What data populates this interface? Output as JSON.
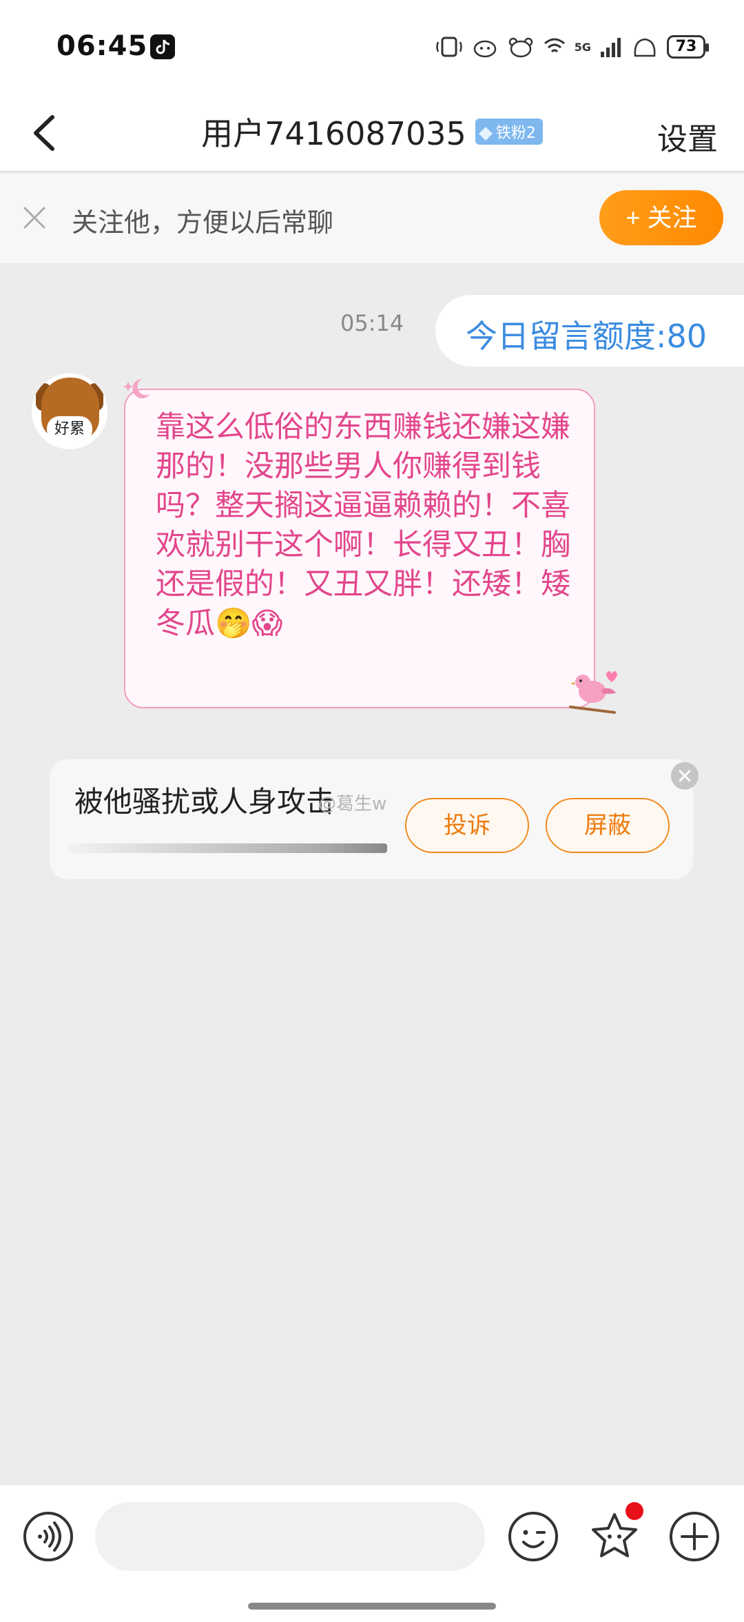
{
  "status_bar": {
    "time": "06:45",
    "app_icon": "tiktok-icon",
    "network": "5G",
    "battery": "73"
  },
  "header": {
    "back_icon": "chevron-left-icon",
    "title": "用户7416087035",
    "badge": "铁粉2",
    "settings": "设置"
  },
  "follow_prompt": {
    "close_icon": "close-icon",
    "text": "关注他，方便以后常聊",
    "button": "+ 关注",
    "button_color": "#ff9100"
  },
  "chat": {
    "timestamp": "05:14",
    "quota_message": "今日留言额度:80",
    "incoming_message": {
      "avatar_label": "好累",
      "text": "靠这么低俗的东西赚钱还嫌这嫌那的！没那些男人你赚得到钱吗？整天搁这逼逼赖赖的！不喜欢就别干这个啊！长得又丑！胸还是假的！又丑又胖！还矮！矮冬瓜🤭😱",
      "text_color": "#e3468c"
    },
    "report_card": {
      "text": "被他骚扰或人身攻击",
      "watermark": "@葛生w",
      "complain": "投诉",
      "block": "屏蔽",
      "accent": "#f08a1e"
    }
  },
  "input_bar": {
    "voice_icon": "voice-icon",
    "input_value": "",
    "emoji_icon": "emoji-icon",
    "gift_icon": "gift-icon",
    "plus_icon": "plus-icon"
  }
}
